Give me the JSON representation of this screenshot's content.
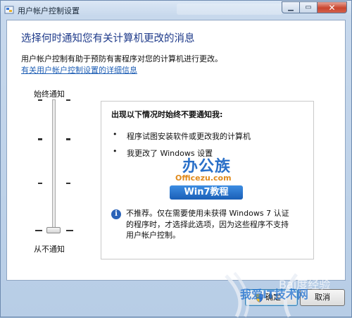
{
  "window": {
    "title": "用户帐户控制设置"
  },
  "main": {
    "heading": "选择何时通知您有关计算机更改的消息",
    "description": "用户帐户控制有助于预防有害程序对您的计算机进行更改。",
    "link": "有关用户帐户控制设置的详细信息"
  },
  "slider": {
    "top_label": "始终通知",
    "bottom_label": "从不通知",
    "level_index": 0,
    "levels_count": 4
  },
  "info": {
    "heading": "出现以下情况时始终不要通知我:",
    "bullets": [
      "程序试图安装软件或更改我的计算机",
      "我更改了 Windows 设置"
    ],
    "note": "不推荐。仅在需要使用未获得 Windows 7 认证的程序时，才选择此选项，因为这些程序不支持用户帐户控制。"
  },
  "watermark": {
    "cn": "办公族",
    "en": "Officezu.com",
    "win": "Win7教程",
    "baidu": "Bai度经验",
    "site": "我爱IT技术网"
  },
  "buttons": {
    "ok": "确定",
    "cancel": "取消"
  },
  "colors": {
    "heading": "#1e3a8a",
    "link": "#1f5fb5",
    "close": "#c9452f"
  }
}
